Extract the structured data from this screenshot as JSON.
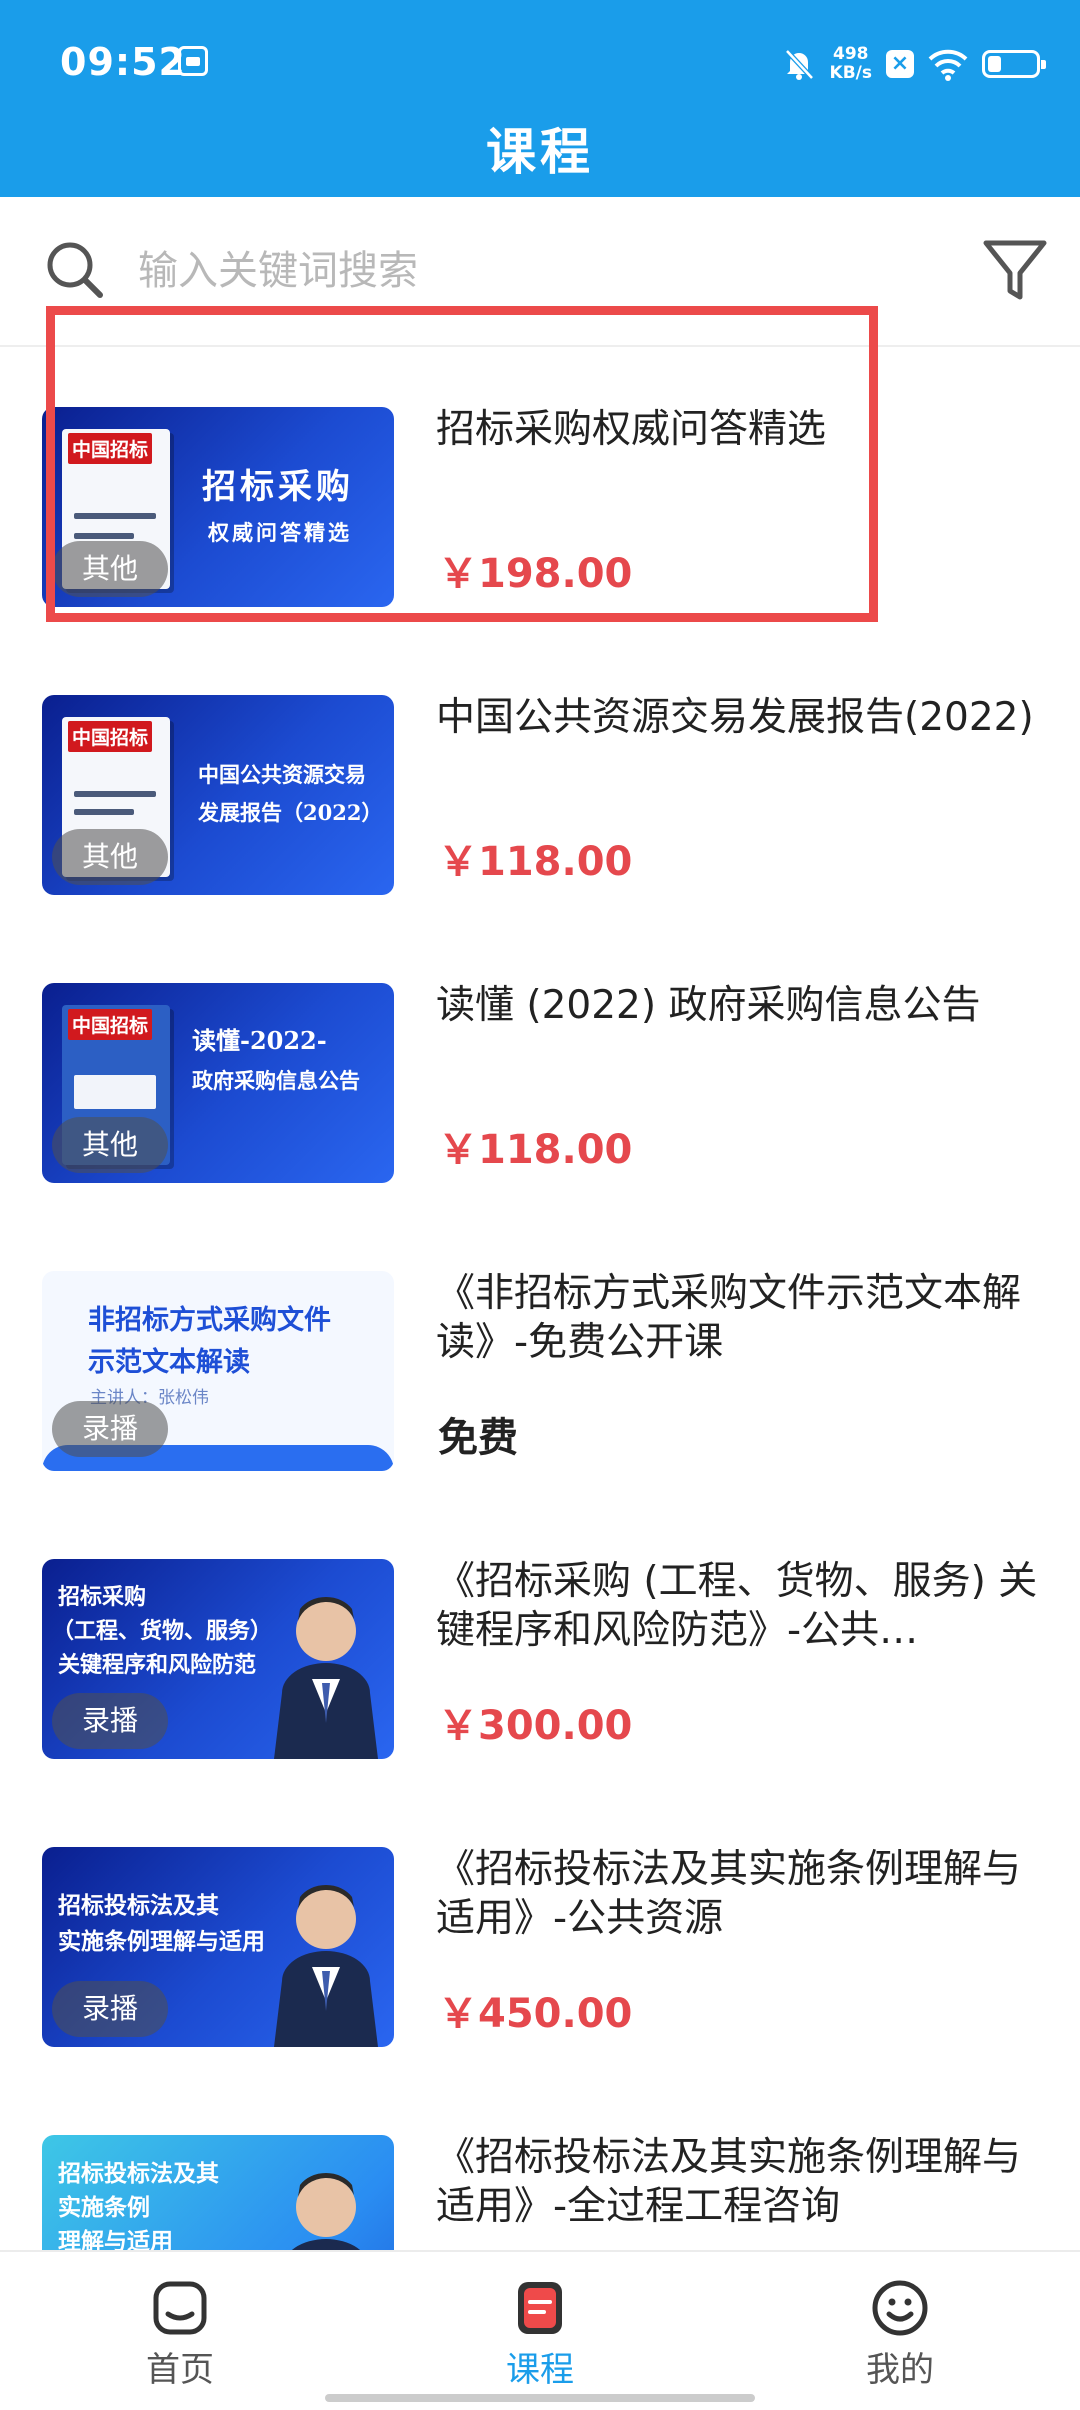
{
  "status_bar": {
    "time": "09:52",
    "net_speed_value": "498",
    "net_speed_unit": "KB/s",
    "battery_icon": "battery-low-icon"
  },
  "header": {
    "title": "课程"
  },
  "search": {
    "placeholder": "输入关键词搜索"
  },
  "courses": [
    {
      "title": "招标采购权威问答精选",
      "price": "￥198.00",
      "tag": "其他",
      "thumb_line1": "招标采购",
      "thumb_line2": "权威问答精选",
      "book_brand": "中国招标"
    },
    {
      "title": "中国公共资源交易发展报告(2022)",
      "price": "￥118.00",
      "tag": "其他",
      "thumb_line1": "中国公共资源交易",
      "thumb_line2": "发展报告（2022）",
      "book_brand": "中国招标"
    },
    {
      "title": "读懂 (2022) 政府采购信息公告",
      "price": "￥118.00",
      "tag": "其他",
      "thumb_line1": "读懂-2022-",
      "thumb_line2": "政府采购信息公告",
      "book_brand": "中国招标"
    },
    {
      "title": "《非招标方式采购文件示范文本解读》-免费公开课",
      "price": "免费",
      "tag": "录播",
      "thumb_line1": "非招标方式采购文件",
      "thumb_line2": "示范文本解读",
      "thumb_line3": "主讲人：张松伟"
    },
    {
      "title": "《招标采购 (工程、货物、服务) 关键程序和风险防范》-公共…",
      "price": "￥300.00",
      "tag": "录播",
      "thumb_line1": "招标采购",
      "thumb_line2": "（工程、货物、服务）",
      "thumb_line3": "关键程序和风险防范"
    },
    {
      "title": "《招标投标法及其实施条例理解与适用》-公共资源",
      "price": "￥450.00",
      "tag": "录播",
      "thumb_line1": "招标投标法及其",
      "thumb_line2": "实施条例理解与适用"
    },
    {
      "title": "《招标投标法及其实施条例理解与适用》-全过程工程咨询",
      "price": "",
      "tag": "",
      "thumb_line1": "招标投标法及其",
      "thumb_line2": "实施条例",
      "thumb_line3": "理解与适用"
    }
  ],
  "bottom_nav": [
    {
      "label": "首页",
      "icon": "home-icon"
    },
    {
      "label": "课程",
      "icon": "course-icon"
    },
    {
      "label": "我的",
      "icon": "smile-icon"
    }
  ],
  "colors": {
    "primary": "#1a9dea",
    "price": "#e5484d",
    "highlight": "#ec4a4a"
  }
}
